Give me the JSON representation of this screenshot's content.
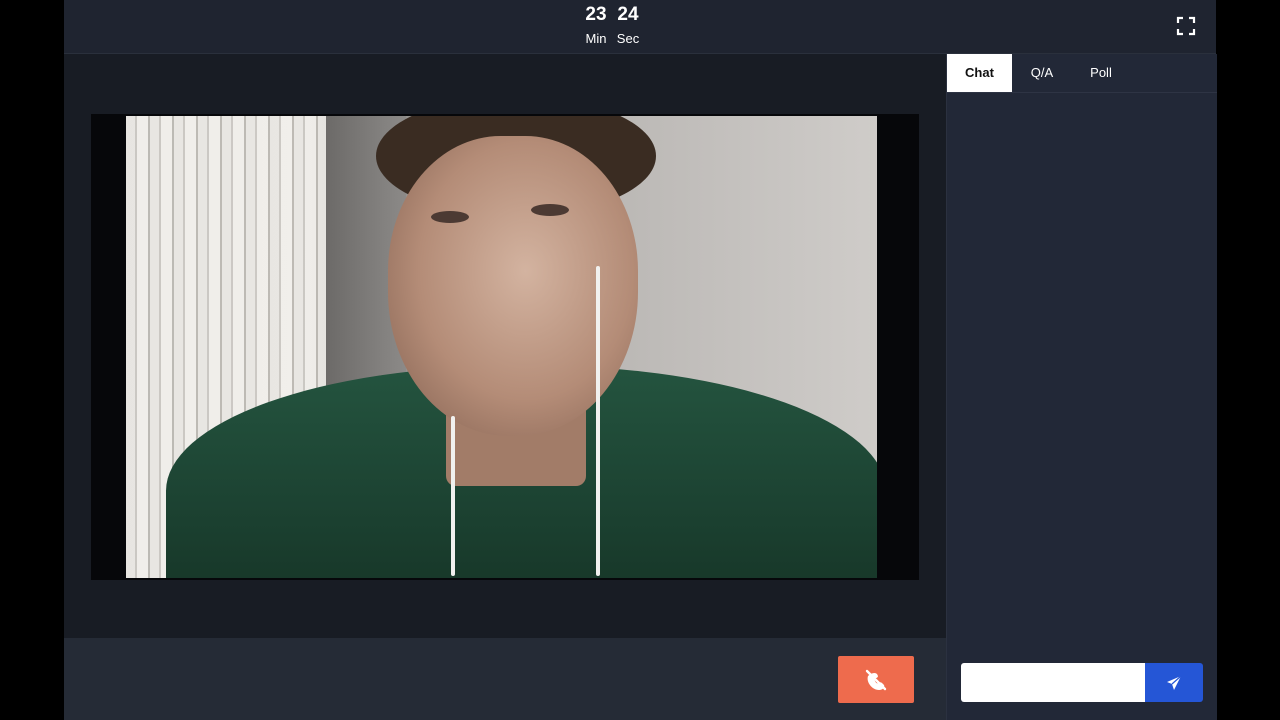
{
  "timer": {
    "minutes": "23",
    "seconds": "24",
    "min_label": "Min",
    "sec_label": "Sec"
  },
  "toolbar": {
    "fullscreen_icon": "fullscreen-icon"
  },
  "video": {
    "content": "participant-webcam-feed"
  },
  "controls": {
    "end_call_icon": "phone-hangup-icon",
    "end_call_color": "#ee6b4d"
  },
  "sidebar": {
    "tabs": [
      {
        "label": "Chat",
        "active": true
      },
      {
        "label": "Q/A",
        "active": false
      },
      {
        "label": "Poll",
        "active": false
      }
    ],
    "message_input": {
      "value": "",
      "placeholder": ""
    },
    "send_icon": "send-icon",
    "send_color": "#2556d6"
  }
}
